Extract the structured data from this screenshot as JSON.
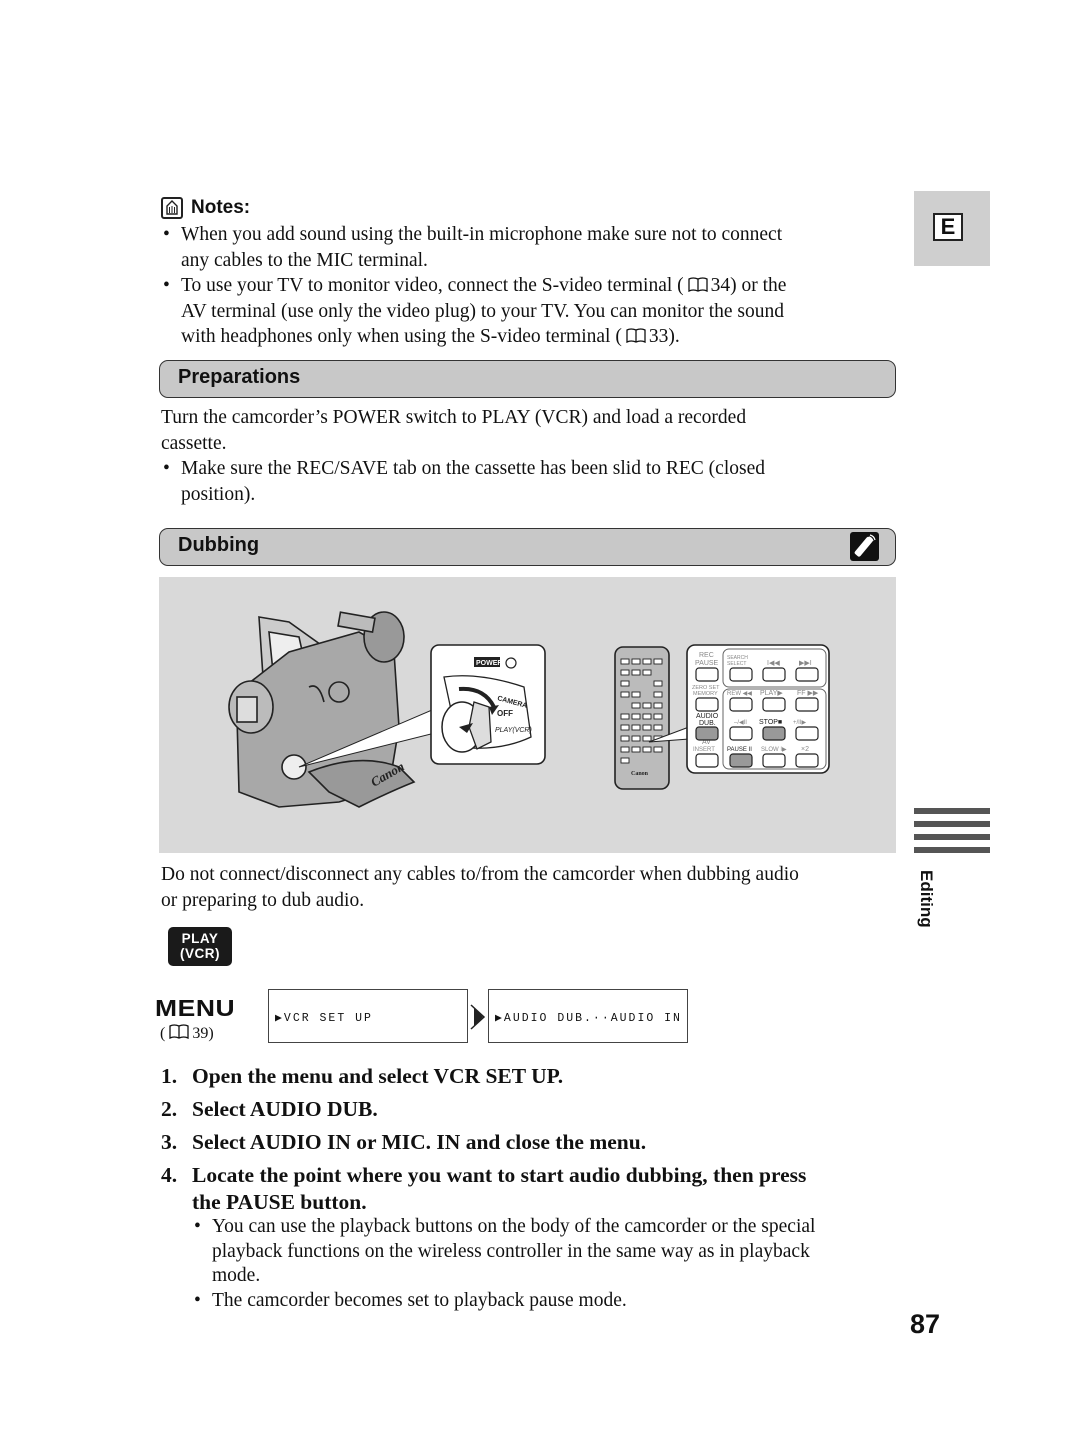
{
  "side_tabs": {
    "language": "E",
    "chapter": "Editing"
  },
  "notes": {
    "title": "Notes:",
    "icon": "notes-pencil-icon",
    "items": [
      {
        "text_lines": [
          "When you add sound using the built-in microphone make sure not to connect",
          "any cables to the MIC terminal."
        ]
      },
      {
        "line1_pre": "To use your TV to monitor video, connect the S-video terminal (",
        "line1_ref": "34",
        "line1_post": ") or the",
        "line2": "AV terminal (use only the video plug) to your TV. You can monitor the sound",
        "line3_pre": "with headphones only when using the S-video terminal (",
        "line3_ref": "33",
        "line3_post": ")."
      }
    ]
  },
  "preparations": {
    "title": "Preparations",
    "paragraph_lines": [
      "Turn the camcorder’s POWER switch to PLAY (VCR) and load a recorded",
      "cassette."
    ],
    "bullet_lines": [
      "Make sure the REC/SAVE tab on the cassette has been slid to REC (closed",
      "position)."
    ]
  },
  "dubbing": {
    "title": "Dubbing",
    "badge_icon": "wireless-controller-icon",
    "figure": {
      "camcorder_brand": "Canon",
      "power_label": "POWER",
      "switch_positions": [
        "CAMERA",
        "OFF",
        "PLAY(VCR)"
      ],
      "remote_brand": "Canon",
      "remote_buttons": [
        [
          "REC PAUSE",
          "SEARCH SELECT",
          "|◀◀",
          "▶▶|"
        ],
        [
          "ZERO SET MEMORY",
          "REW ◀◀",
          "PLAY ▶",
          "FF ▶▶"
        ],
        [
          "AUDIO DUB.",
          "–/◀II",
          "STOP ■",
          "+/II▶"
        ],
        [
          "AV INSERT",
          "PAUSE II",
          "SLOW I▶",
          "×2"
        ]
      ],
      "highlighted_buttons": [
        "AUDIO DUB.",
        "STOP ■",
        "PAUSE II"
      ]
    },
    "warning_lines": [
      "Do not connect/disconnect any cables to/from the camcorder when dubbing audio",
      "or preparing to dub audio."
    ],
    "mode_badge": {
      "line1": "PLAY",
      "line2": "(VCR)"
    },
    "menu": {
      "label": "MENU",
      "ref_pre": "(",
      "ref_page": "39)",
      "screen1": "▶VCR SET UP",
      "screen2": "▶AUDIO DUB.··AUDIO IN"
    },
    "steps": [
      {
        "num": "1.",
        "lines": [
          "Open the menu and select VCR SET UP."
        ]
      },
      {
        "num": "2.",
        "lines": [
          "Select AUDIO DUB."
        ]
      },
      {
        "num": "3.",
        "lines": [
          "Select AUDIO IN or MIC. IN and close the menu."
        ]
      },
      {
        "num": "4.",
        "lines": [
          "Locate the point where you want to start audio dubbing, then press",
          "the PAUSE button."
        ]
      }
    ],
    "step4_bullets": [
      {
        "lines": [
          "You can use the playback buttons on the body of the camcorder or the special",
          "playback functions on the wireless controller in the same way as in playback",
          "mode."
        ]
      },
      {
        "lines": [
          "The camcorder becomes set to playback pause mode."
        ]
      }
    ]
  },
  "page_number": "87"
}
